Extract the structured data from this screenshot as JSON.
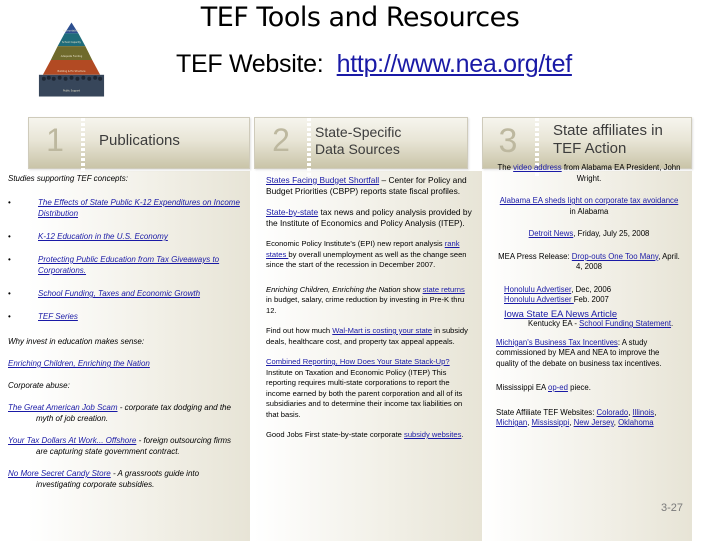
{
  "slide": {
    "title": "TEF Tools and Resources",
    "website_label": "TEF Website:",
    "website_url": "http://www.nea.org/tef",
    "page_number": "3-27"
  },
  "logo": {
    "icon": "tef-pyramid-logo",
    "tiers": [
      "Accountability",
      "School Capacity",
      "Adequate Funding",
      "Building & Fin Structure",
      "Public Support"
    ]
  },
  "columns": [
    {
      "number": "1",
      "heading": "Publications",
      "intro": "Studies supporting TEF concepts:",
      "bullets": [
        {
          "link": "The Effects of State Public K-12 Expenditures on Income Distribution"
        },
        {
          "link": "K-12 Education in the U.S. Economy"
        },
        {
          "link": "Protecting Public Education from Tax Giveaways to Corporations."
        },
        {
          "link": "School Funding, Taxes and Economic Growth"
        },
        {
          "link": "TEF Series"
        }
      ],
      "why_label": "Why invest in education makes sense:",
      "why_link": "Enriching Children, Enriching the Nation",
      "abuse_label": "Corporate abuse:",
      "abuse_items": [
        {
          "link": "The Great American Job Scam",
          "text": " - corporate tax dodging and the myth of job creation."
        },
        {
          "link": "Your Tax Dollars At Work... Offshore",
          "text": " - foreign outsourcing firms are capturing state government contract."
        },
        {
          "link": "No More Secret Candy Store",
          "text": " - A grassroots guide into investigating corporate subsidies."
        }
      ]
    },
    {
      "number": "2",
      "heading_line1": "State-Specific",
      "heading_line2": "Data Sources",
      "p1_link": "States Facing Budget Shortfall",
      "p1_text": " – Center for Policy and Budget Priorities (CBPP) reports state fiscal profiles.",
      "p2_link": "State-by-state",
      "p2_text": " tax news and policy analysis provided by the Institute of Economics and Policy Analysis (ITEP).",
      "p3_pre": "Economic Policy Institute's (EPI) new report analysis ",
      "p3_link": "rank states ",
      "p3_post": "by overall unemployment as well as the change seen since the start of the recession in December 2007.",
      "p4_italic": "Enriching Children, Enriching the Nation",
      "p4_pre": " show ",
      "p4_link": "state returns ",
      "p4_post": "in budget, salary, crime reduction by investing in Pre-K thru 12.",
      "p5_pre": "Find out how much ",
      "p5_link": "Wal-Mart is costing your state",
      "p5_post": " in subsidy deals, healthcare cost, and property tax appeal appeals.",
      "p6_link": "Combined Reporting, How Does Your State Stack-Up? ",
      "p6_text": " Institute on Taxation and Economic Policy (ITEP) This reporting requires multi-state corporations to report the income earned by both the parent corporation and all of its subsidiaries and to determine their income tax liabilities on that basis.",
      "p7_pre": "Good Jobs First state-by-state corporate ",
      "p7_link": "subsidy websites",
      "p7_post": "."
    },
    {
      "number": "3",
      "heading_line1": "State affiliates in",
      "heading_line2": "TEF Action",
      "a1_pre": "The ",
      "a1_link": "video address",
      "a1_post": " from Alabama EA President, John Wright.",
      "a2_link": "Alabama EA sheds light on corporate tax avoidance",
      "a2_post": " in Alabama",
      "a3_link": "Detroit News",
      "a3_post": ", Friday, July 25, 2008",
      "a4_pre": "MEA Press Release: ",
      "a4_link": "Drop-outs One Too Many",
      "a4_post": ", April. 4, 2008",
      "a5_link": "Honolulu Advertiser",
      "a5_post": ", Dec, 2006",
      "a6_link": "Honolulu Advertiser ",
      "a6_post": "Feb. 2007",
      "a7_link": "Iowa State EA News Article",
      "a8_pre": "Kentucky EA - ",
      "a8_link": "School Funding Statement",
      "a8_post": ".",
      "a9_link": "Michigan's Business Tax Incentives",
      "a9_post": ": A study commissioned by MEA and NEA to improve the quality of the debate on business tax incentives.",
      "a10_pre": "Mississippi EA ",
      "a10_link": "op-ed",
      "a10_post": " piece.",
      "a11_pre": "State Affiliate TEF Websites: ",
      "a11_links": [
        "Colorado",
        "Illinois",
        "Michigan",
        "Mississippi",
        "New Jersey",
        "Oklahoma"
      ]
    }
  ]
}
